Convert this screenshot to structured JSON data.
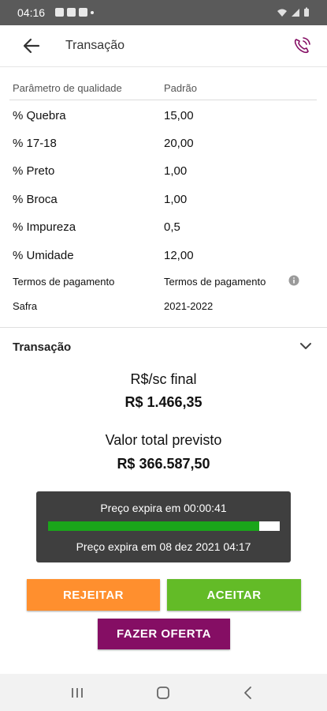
{
  "status_bar": {
    "time": "04:16",
    "left_icons": [
      "image-icon",
      "gmail-icon",
      "bag-icon",
      "dot-icon"
    ],
    "right_icons": [
      "wifi-icon",
      "signal-icon",
      "battery-icon"
    ]
  },
  "header": {
    "title": "Transação",
    "back_icon": "arrow-left-icon",
    "phone_icon": "phone-ring-icon",
    "accent_color": "#850e64"
  },
  "params": {
    "header_param": "Parâmetro de qualidade",
    "header_value": "Padrão",
    "rows": [
      {
        "label": "% Quebra",
        "value": "15,00"
      },
      {
        "label": "% 17-18",
        "value": "20,00"
      },
      {
        "label": "% Preto",
        "value": "1,00"
      },
      {
        "label": "% Broca",
        "value": "1,00"
      },
      {
        "label": "% Impureza",
        "value": "0,5"
      },
      {
        "label": "% Umidade",
        "value": "12,00"
      }
    ],
    "payment_label": "Termos de pagamento",
    "payment_value": "Termos de pagamento",
    "harvest_label": "Safra",
    "harvest_value": "2021-2022"
  },
  "transaction": {
    "section_title": "Transação",
    "price_label": "R$/sc final",
    "price_value": "R$ 1.466,35",
    "total_label": "Valor total previsto",
    "total_value": "R$ 366.587,50"
  },
  "timer": {
    "expires_in": "Preço expira em 00:00:41",
    "progress": 0.91,
    "expires_at": "Preço expira em 08 dez 2021 04:17",
    "bar_color": "#1aa51a"
  },
  "actions": {
    "reject": "REJEITAR",
    "accept": "ACEITAR",
    "offer": "FAZER OFERTA"
  },
  "colors": {
    "reject": "#ff8f2e",
    "accept": "#63bb27",
    "offer": "#850e64"
  },
  "nav": [
    "recents-icon",
    "home-icon",
    "back-icon"
  ]
}
